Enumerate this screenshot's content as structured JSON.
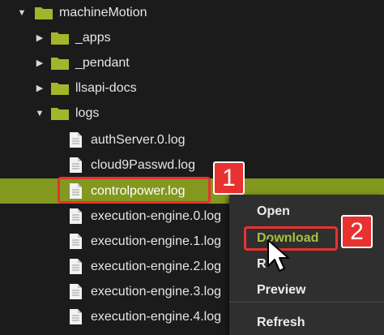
{
  "tree": {
    "root": {
      "label": "machineMotion"
    },
    "folders": [
      {
        "label": "_apps"
      },
      {
        "label": "_pendant"
      },
      {
        "label": "llsapi-docs"
      },
      {
        "label": "logs"
      }
    ],
    "files": [
      {
        "label": "authServer.0.log"
      },
      {
        "label": "cloud9Passwd.log"
      },
      {
        "label": "controlpower.log"
      },
      {
        "label": "execution-engine.0.log"
      },
      {
        "label": "execution-engine.1.log"
      },
      {
        "label": "execution-engine.2.log"
      },
      {
        "label": "execution-engine.3.log"
      },
      {
        "label": "execution-engine.4.log"
      }
    ]
  },
  "context_menu": {
    "items": [
      {
        "label": "Open"
      },
      {
        "label": "Download"
      },
      {
        "label": "R"
      },
      {
        "label": "Preview"
      },
      {
        "label": "Refresh"
      }
    ]
  },
  "annotations": {
    "step1": "1",
    "step2": "2",
    "color": "#e8322f"
  },
  "colors": {
    "selection": "#82981e",
    "folder": "#a3b52a",
    "menu_background": "#2f2f2f",
    "hover_text": "#a6c23a"
  }
}
